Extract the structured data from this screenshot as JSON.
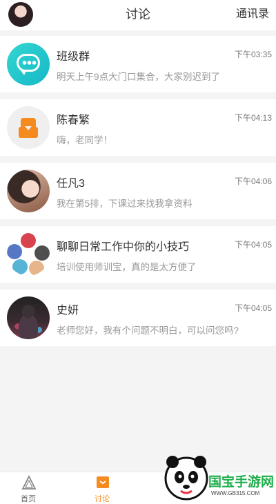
{
  "header": {
    "title": "讨论",
    "contacts_label": "通讯录"
  },
  "chats": [
    {
      "name": "班级群",
      "time": "下午03:35",
      "message": "明天上午9点大门口集合，大家别迟到了",
      "avatar": "group-chat-icon"
    },
    {
      "name": "陈春繁",
      "time": "下午04:13",
      "message": "嗨，老同学！",
      "avatar": "default-user-icon"
    },
    {
      "name": "任凡3",
      "time": "下午04:06",
      "message": "我在第5排，下课过来找我拿资料",
      "avatar": "photo"
    },
    {
      "name": "聊聊日常工作中你的小技巧",
      "time": "下午04:05",
      "message": "培训使用师训宝，真的是太方便了",
      "avatar": "group-members"
    },
    {
      "name": "史妍",
      "time": "下午04:05",
      "message": "老师您好，我有个问题不明白，可以问您吗?",
      "avatar": "photo"
    }
  ],
  "tabbar": {
    "home_label": "首页",
    "discuss_label": "讨论"
  },
  "watermark": {
    "brand": "国宝手游网",
    "url": "WWW.GB315.COM"
  },
  "colors": {
    "accent": "#f58a1f",
    "group_avatar": "#22c4cc"
  }
}
